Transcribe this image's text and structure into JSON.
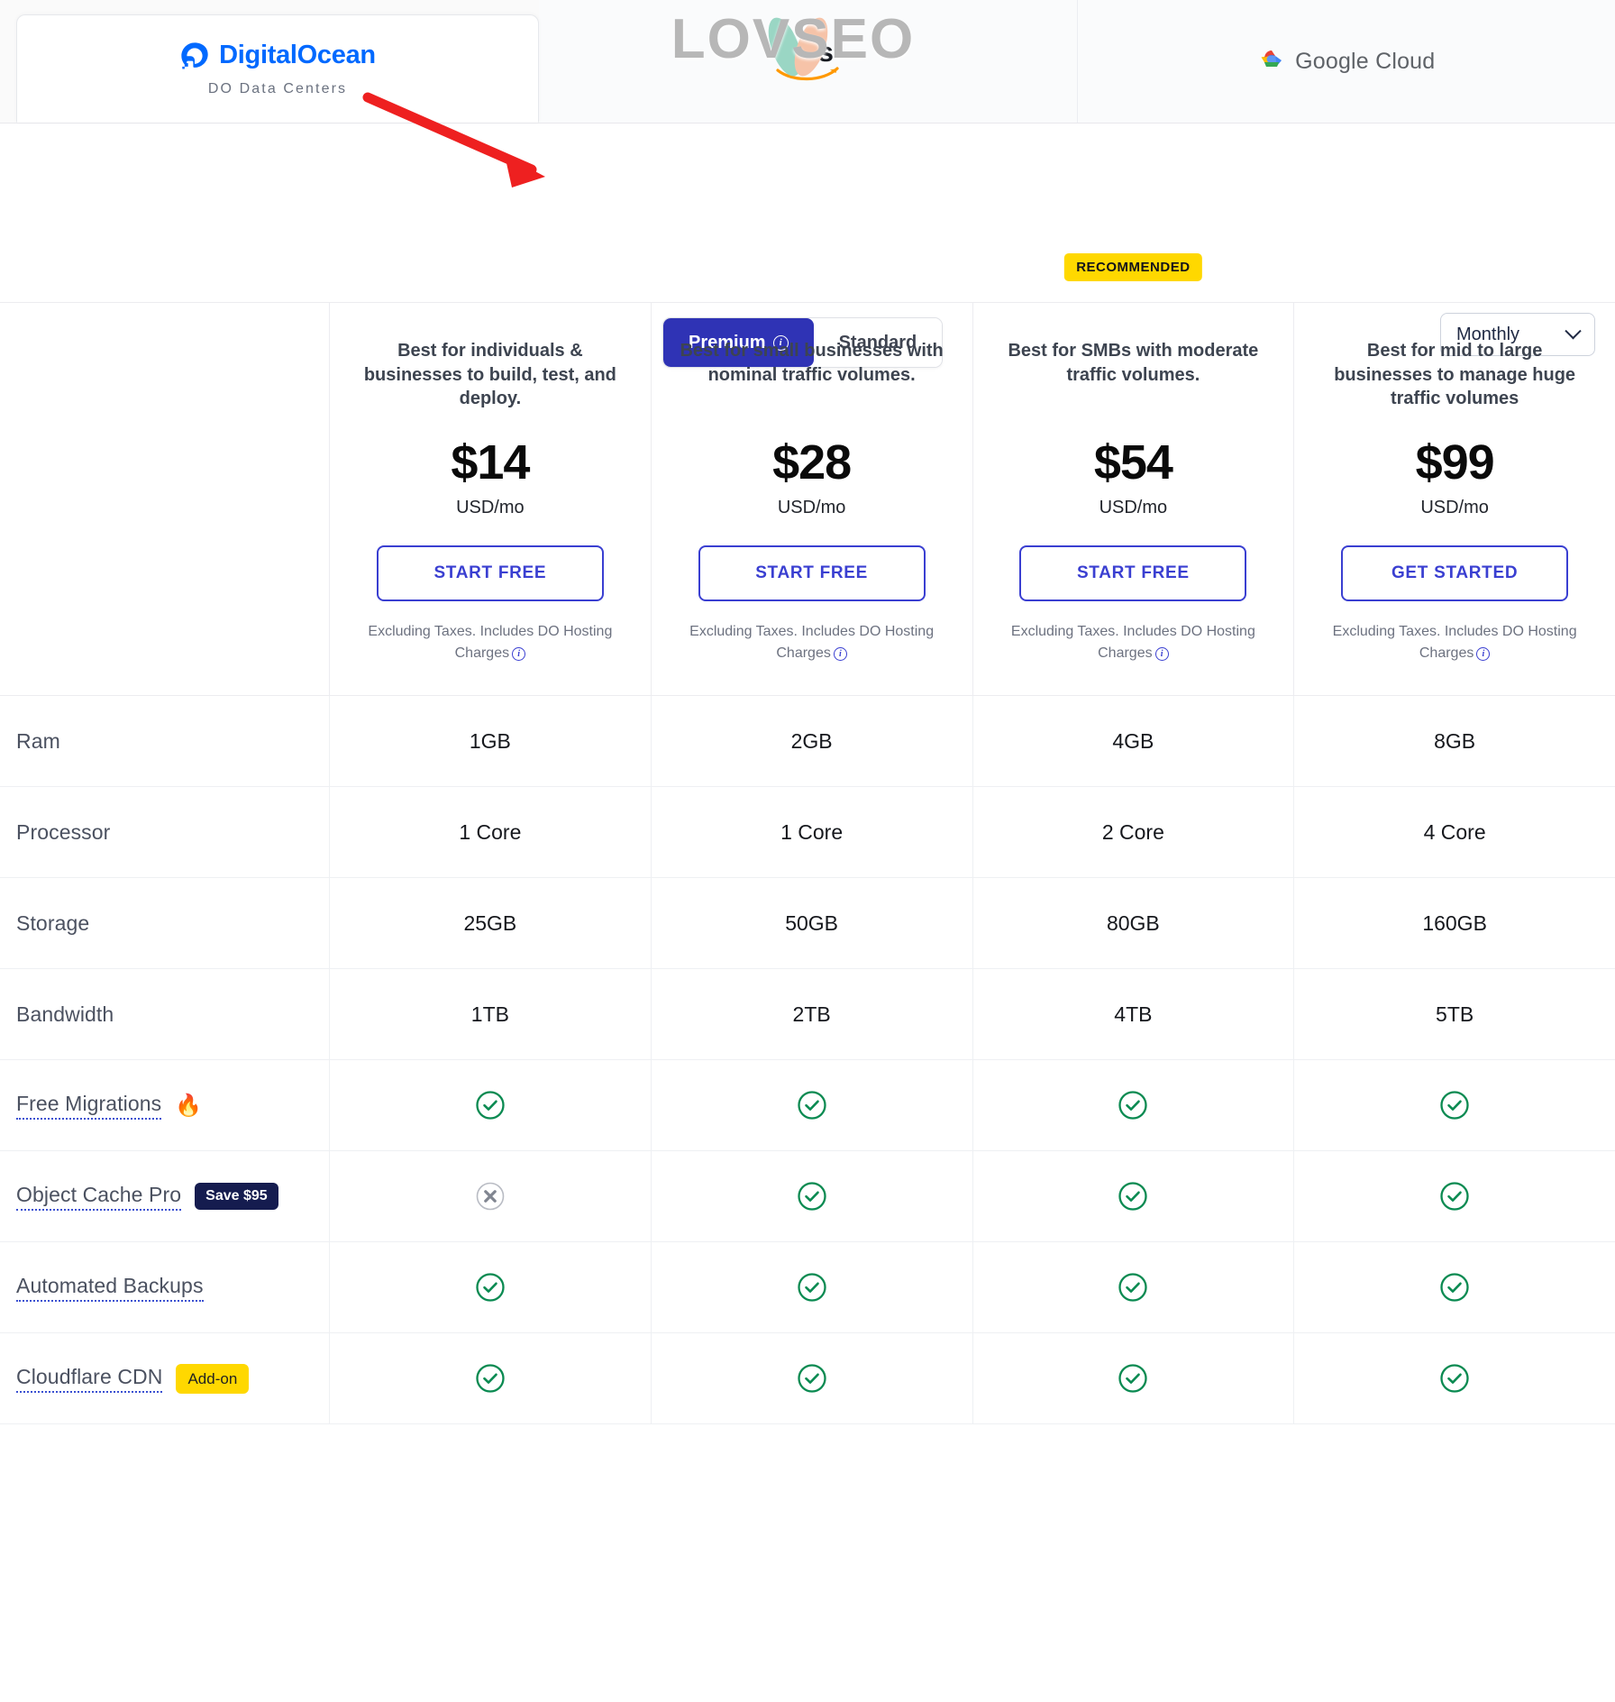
{
  "providers": [
    {
      "id": "digitalocean",
      "name": "DigitalOcean",
      "sublabel": "DO Data Centers",
      "active": true
    },
    {
      "id": "aws",
      "name": "aws",
      "sublabel": "",
      "active": false
    },
    {
      "id": "google-cloud",
      "name": "Google Cloud",
      "sublabel": "",
      "active": false
    }
  ],
  "watermark": {
    "text": "LOVSEO"
  },
  "controls": {
    "tabs": [
      {
        "label": "Premium",
        "info": "i",
        "active": true
      },
      {
        "label": "Standard",
        "info": "",
        "active": false
      }
    ],
    "period": {
      "value": "Monthly",
      "icon": "chevron-down-icon"
    }
  },
  "table": {
    "recommended_badge": "RECOMMENDED",
    "recommended_index": 2,
    "plans": [
      {
        "description": "Best for individuals & businesses to build, test, and deploy.",
        "price": "$14",
        "unit": "USD/mo",
        "cta": "START FREE",
        "note": "Excluding Taxes. Includes DO Hosting Charges"
      },
      {
        "description": "Best for small businesses with nominal traffic volumes.",
        "price": "$28",
        "unit": "USD/mo",
        "cta": "START FREE",
        "note": "Excluding Taxes. Includes DO Hosting Charges"
      },
      {
        "description": "Best for SMBs with moderate traffic volumes.",
        "price": "$54",
        "unit": "USD/mo",
        "cta": "START FREE",
        "note": "Excluding Taxes. Includes DO Hosting Charges"
      },
      {
        "description": "Best for mid to large businesses to manage huge traffic volumes",
        "price": "$99",
        "unit": "USD/mo",
        "cta": "GET STARTED",
        "note": "Excluding Taxes. Includes DO Hosting Charges"
      }
    ],
    "rows": [
      {
        "label": "Ram",
        "tooltip": false,
        "badge": null,
        "emoji": null,
        "values": [
          "1GB",
          "2GB",
          "4GB",
          "8GB"
        ],
        "type": "text"
      },
      {
        "label": "Processor",
        "tooltip": false,
        "badge": null,
        "emoji": null,
        "values": [
          "1 Core",
          "1 Core",
          "2 Core",
          "4 Core"
        ],
        "type": "text"
      },
      {
        "label": "Storage",
        "tooltip": false,
        "badge": null,
        "emoji": null,
        "values": [
          "25GB",
          "50GB",
          "80GB",
          "160GB"
        ],
        "type": "text"
      },
      {
        "label": "Bandwidth",
        "tooltip": false,
        "badge": null,
        "emoji": null,
        "values": [
          "1TB",
          "2TB",
          "4TB",
          "5TB"
        ],
        "type": "text"
      },
      {
        "label": "Free Migrations",
        "tooltip": true,
        "badge": null,
        "emoji": "🔥",
        "values": [
          "check",
          "check",
          "check",
          "check"
        ],
        "type": "mark"
      },
      {
        "label": "Object Cache Pro",
        "tooltip": true,
        "badge": {
          "text": "Save $95",
          "style": "dark"
        },
        "emoji": null,
        "values": [
          "cross",
          "check",
          "check",
          "check"
        ],
        "type": "mark"
      },
      {
        "label": "Automated Backups",
        "tooltip": true,
        "badge": null,
        "emoji": null,
        "values": [
          "check",
          "check",
          "check",
          "check"
        ],
        "type": "mark"
      },
      {
        "label": "Cloudflare CDN",
        "tooltip": true,
        "badge": {
          "text": "Add-on",
          "style": "yellow"
        },
        "emoji": null,
        "values": [
          "check",
          "check",
          "check",
          "check"
        ],
        "type": "mark"
      }
    ]
  },
  "colors": {
    "primary": "#2f33b5",
    "cta_border": "#3a3fd1",
    "check_green": "#0a8a51",
    "badge_yellow": "#ffd800",
    "badge_dark": "#151c4f",
    "do_blue": "#0069ff"
  },
  "annotation": {
    "arrow": "red-arrow-pointing-to-premium-tab",
    "color": "#ee2020"
  }
}
